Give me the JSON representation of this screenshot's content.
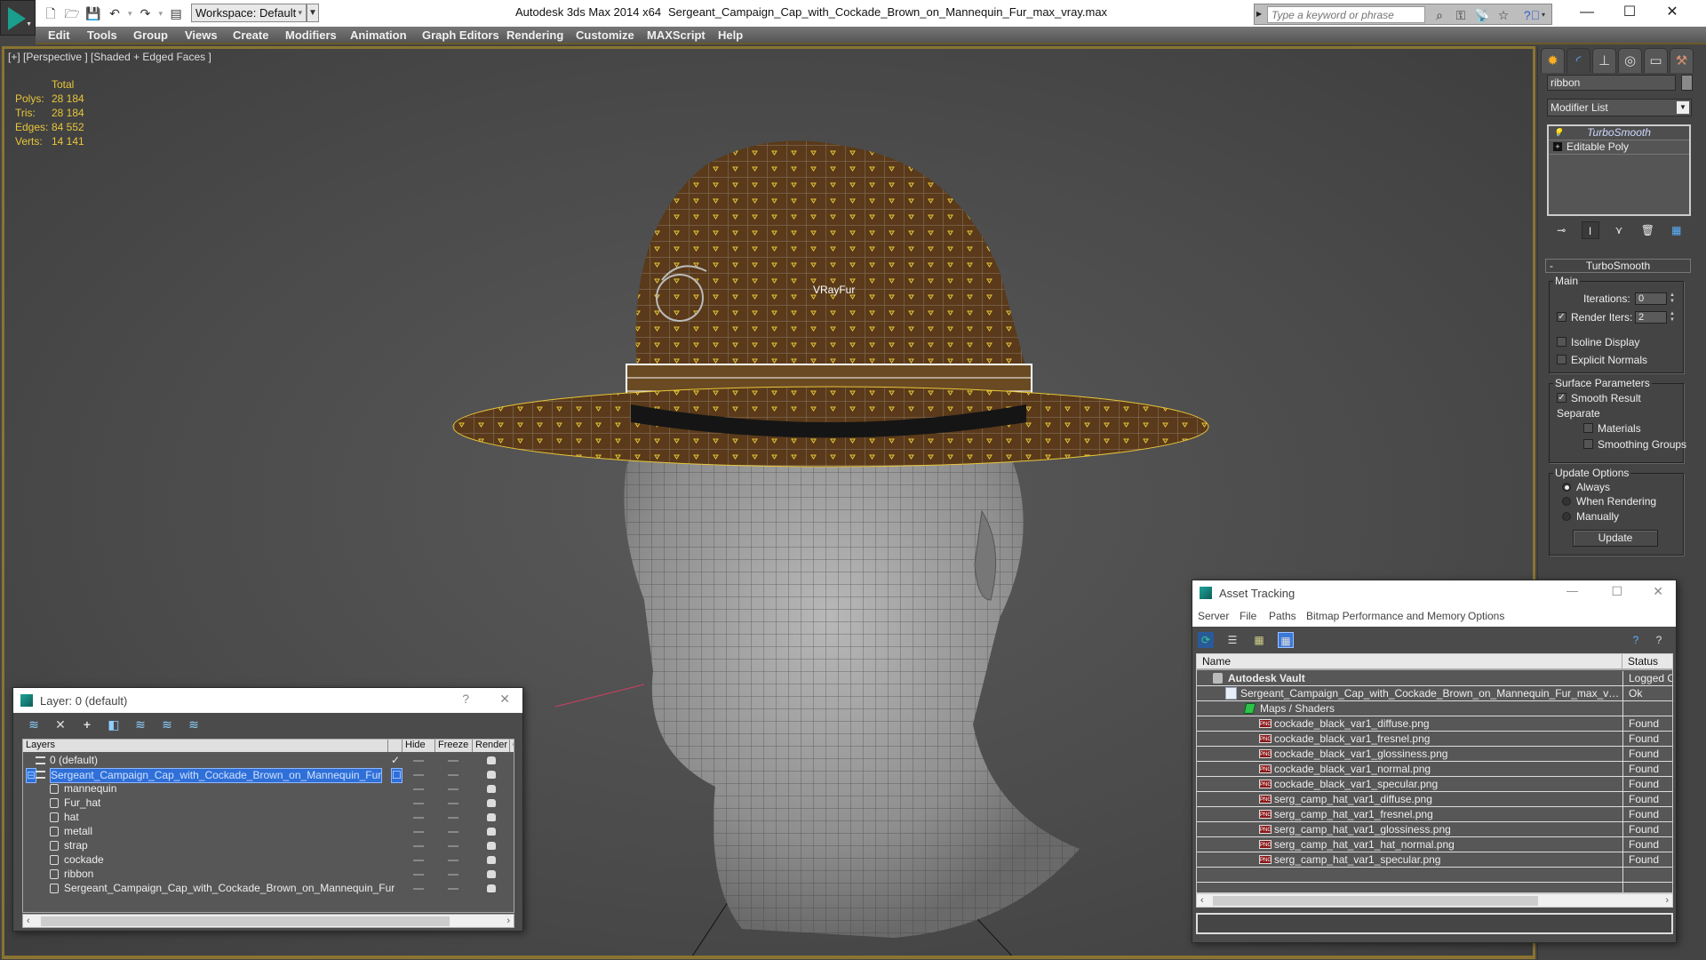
{
  "titlebar": {
    "workspace": "Workspace: Default",
    "app_title": "Autodesk 3ds Max  2014 x64",
    "doc_title": "Sergeant_Campaign_Cap_with_Cockade_Brown_on_Mannequin_Fur_max_vray.max",
    "search_placeholder": "Type a keyword or phrase",
    "quick_access_icons": [
      "new-file-icon",
      "open-file-icon",
      "save-icon",
      "undo-icon",
      "redo-icon",
      "project-folder-icon"
    ],
    "search_tools": [
      "binoculars-icon",
      "key-icon",
      "satellite-icon",
      "star-icon",
      "help-icon"
    ],
    "window_controls": {
      "minimize": "—",
      "maximize": "☐",
      "close": "✕"
    }
  },
  "menubar": {
    "items": [
      "Edit",
      "Tools",
      "Group",
      "Views",
      "Create",
      "Modifiers",
      "Animation",
      "Graph Editors",
      "Rendering",
      "Customize",
      "MAXScript",
      "Help"
    ]
  },
  "viewport": {
    "label": "[+] [Perspective ] [Shaded + Edged Faces ]",
    "stats": {
      "header": "Total",
      "rows": [
        {
          "label": "Polys:",
          "value": "28 184"
        },
        {
          "label": "Tris:",
          "value": "28 184"
        },
        {
          "label": "Edges:",
          "value": "84 552"
        },
        {
          "label": "Verts:",
          "value": "14 141"
        }
      ]
    },
    "object_label": "VRayFur",
    "colors": {
      "stats": "#e8c63a",
      "border": "#8a7430",
      "hat": "#5a3a1a",
      "wire": "#e8c63a"
    }
  },
  "command_panel": {
    "tabs": [
      "create-tab",
      "modify-tab",
      "hierarchy-tab",
      "motion-tab",
      "display-tab",
      "utilities-tab"
    ],
    "object_name": "ribbon",
    "modifier_list": "Modifier List",
    "stack": [
      "TurboSmooth",
      "Editable Poly"
    ],
    "turbosmooth": {
      "title": "TurboSmooth",
      "main": {
        "label": "Main",
        "iterations_label": "Iterations:",
        "iterations": "0",
        "render_iters_label": "Render Iters:",
        "render_iters": "2",
        "render_iters_checked": true,
        "isoline_label": "Isoline Display",
        "isoline_checked": false,
        "explicit_normals_label": "Explicit Normals",
        "explicit_normals_checked": false
      },
      "surface": {
        "label": "Surface Parameters",
        "smooth_result_label": "Smooth Result",
        "smooth_result_checked": true,
        "separate_label": "Separate",
        "materials_label": "Materials",
        "materials_checked": false,
        "smoothing_groups_label": "Smoothing Groups",
        "smoothing_groups_checked": false
      },
      "update": {
        "label": "Update Options",
        "options": [
          "Always",
          "When Rendering",
          "Manually"
        ],
        "selected": "Always",
        "button": "Update"
      }
    }
  },
  "layer_dialog": {
    "title": "Layer: 0 (default)",
    "help": "?",
    "close": "✕",
    "toolbar": [
      "create-layer-icon",
      "delete-layer-icon",
      "add-to-layer-icon",
      "select-objects-icon",
      "select-layer-icon",
      "layer-properties-icon",
      "layer-settings-icon"
    ],
    "columns": [
      "Layers",
      "",
      "Hide",
      "Freeze",
      "Render",
      "C"
    ],
    "rows": [
      {
        "name": "0 (default)",
        "type": "layer",
        "indent": 1,
        "current": true
      },
      {
        "name": "Sergeant_Campaign_Cap_with_Cockade_Brown_on_Mannequin_Fur",
        "type": "layer",
        "indent": 1,
        "selected": true,
        "expanded": true
      },
      {
        "name": "mannequin",
        "type": "object",
        "indent": 2
      },
      {
        "name": "Fur_hat",
        "type": "object",
        "indent": 2
      },
      {
        "name": "hat",
        "type": "object",
        "indent": 2
      },
      {
        "name": "metall",
        "type": "object",
        "indent": 2
      },
      {
        "name": "strap",
        "type": "object",
        "indent": 2
      },
      {
        "name": "cockade",
        "type": "object",
        "indent": 2
      },
      {
        "name": "ribbon",
        "type": "object",
        "indent": 2
      },
      {
        "name": "Sergeant_Campaign_Cap_with_Cockade_Brown_on_Mannequin_Fur",
        "type": "object",
        "indent": 2
      }
    ]
  },
  "asset_dialog": {
    "title": "Asset Tracking",
    "menu": [
      "Server",
      "File",
      "Paths",
      "Bitmap Performance and Memory",
      "Options"
    ],
    "toolbar": [
      "refresh-icon",
      "list-view-icon",
      "thumbnail-view-icon",
      "table-view-icon"
    ],
    "columns": [
      "Name",
      "Status"
    ],
    "rows": [
      {
        "name": "Autodesk Vault",
        "status": "Logged Out",
        "type": "vault",
        "indent": 1
      },
      {
        "name": "Sergeant_Campaign_Cap_with_Cockade_Brown_on_Mannequin_Fur_max_vray....",
        "status": "Ok",
        "type": "max",
        "indent": 2
      },
      {
        "name": "Maps / Shaders",
        "status": "",
        "type": "maps",
        "indent": 3
      },
      {
        "name": "cockade_black_var1_diffuse.png",
        "status": "Found",
        "type": "png",
        "indent": 4
      },
      {
        "name": "cockade_black_var1_fresnel.png",
        "status": "Found",
        "type": "png",
        "indent": 4
      },
      {
        "name": "cockade_black_var1_glossiness.png",
        "status": "Found",
        "type": "png",
        "indent": 4
      },
      {
        "name": "cockade_black_var1_normal.png",
        "status": "Found",
        "type": "png",
        "indent": 4
      },
      {
        "name": "cockade_black_var1_specular.png",
        "status": "Found",
        "type": "png",
        "indent": 4
      },
      {
        "name": "serg_camp_hat_var1_diffuse.png",
        "status": "Found",
        "type": "png",
        "indent": 4
      },
      {
        "name": "serg_camp_hat_var1_fresnel.png",
        "status": "Found",
        "type": "png",
        "indent": 4
      },
      {
        "name": "serg_camp_hat_var1_glossiness.png",
        "status": "Found",
        "type": "png",
        "indent": 4
      },
      {
        "name": "serg_camp_hat_var1_hat_normal.png",
        "status": "Found",
        "type": "png",
        "indent": 4
      },
      {
        "name": "serg_camp_hat_var1_specular.png",
        "status": "Found",
        "type": "png",
        "indent": 4
      }
    ],
    "path_field": ""
  }
}
